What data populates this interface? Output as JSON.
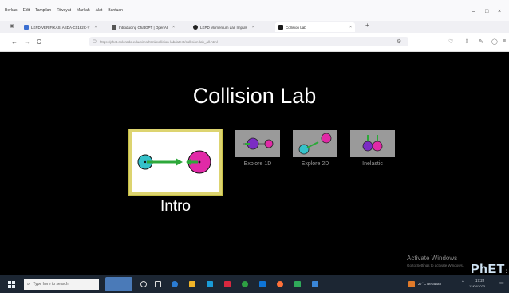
{
  "menu": [
    "Berkas",
    "Edit",
    "Tampilan",
    "Riwayat",
    "Markah",
    "Alat",
    "Bantuan"
  ],
  "window_controls": [
    "–",
    "□",
    "×"
  ],
  "tabs": [
    {
      "title": "LKPD VERIFIKASI ASDA-C0182C-Y",
      "color": "#3b6fd1"
    },
    {
      "title": "Introducing ChatGPT | OpenAI",
      "color": "#555555"
    },
    {
      "title": "LKPD Momentum dan Impuls",
      "color": "#222222"
    },
    {
      "title": "Collision Lab",
      "color": "#1a1a1a"
    }
  ],
  "tab_close": "×",
  "new_tab": "+",
  "nav": {
    "back": "←",
    "forward": "→",
    "reload": "C",
    "lock": "🔒"
  },
  "address": "https://phet.colorado.edu/sims/html/collision-lab/latest/collision-lab_all.html",
  "sim": {
    "title": "Collision Lab",
    "screens": [
      {
        "label": "Intro",
        "selected": true
      },
      {
        "label": "Explore 1D",
        "selected": false
      },
      {
        "label": "Explore 2D",
        "selected": false
      },
      {
        "label": "Inelastic",
        "selected": false
      }
    ],
    "logo": "PhET"
  },
  "activation": {
    "title": "Activate Windows",
    "subtitle": "Go to Settings to activate Windows."
  },
  "taskbar": {
    "search_placeholder": "Type here to search",
    "weather": "27°C Berawan",
    "time": "17:22",
    "date": "12/04/2023"
  },
  "colors": {
    "sim_bg": "#000000",
    "ball_cyan": "#35c1c9",
    "ball_magenta": "#e12aa7",
    "ball_purple": "#7b2cc4",
    "arrow_green": "#2da83a",
    "selected_border": "#ddd470",
    "taskbar_bg": "#1c2633"
  }
}
